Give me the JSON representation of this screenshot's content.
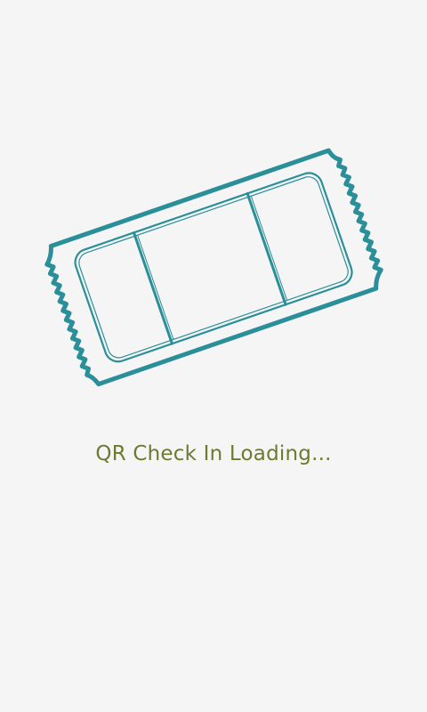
{
  "splash": {
    "loading_text": "QR Check In Loading...",
    "illustration_icon": "ticket-icon"
  },
  "colors": {
    "background": "#f5f5f5",
    "ticket_stroke": "#2a8f98",
    "text": "#6d7a2f"
  }
}
